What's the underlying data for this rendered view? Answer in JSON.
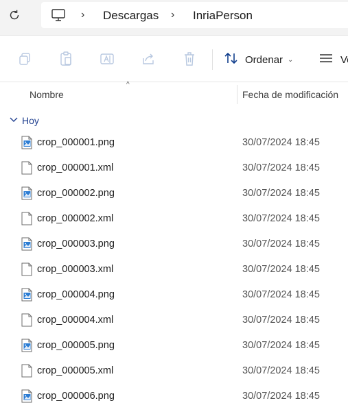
{
  "address": {
    "crumbs": [
      "Descargas",
      "InriaPerson"
    ]
  },
  "toolbar": {
    "sort_label": "Ordenar",
    "view_label": "Ver"
  },
  "columns": {
    "name": "Nombre",
    "date": "Fecha de modificación"
  },
  "group": {
    "label": "Hoy"
  },
  "files": [
    {
      "name": "crop_000001.png",
      "date": "30/07/2024 18:45",
      "type": "png"
    },
    {
      "name": "crop_000001.xml",
      "date": "30/07/2024 18:45",
      "type": "xml"
    },
    {
      "name": "crop_000002.png",
      "date": "30/07/2024 18:45",
      "type": "png"
    },
    {
      "name": "crop_000002.xml",
      "date": "30/07/2024 18:45",
      "type": "xml"
    },
    {
      "name": "crop_000003.png",
      "date": "30/07/2024 18:45",
      "type": "png"
    },
    {
      "name": "crop_000003.xml",
      "date": "30/07/2024 18:45",
      "type": "xml"
    },
    {
      "name": "crop_000004.png",
      "date": "30/07/2024 18:45",
      "type": "png"
    },
    {
      "name": "crop_000004.xml",
      "date": "30/07/2024 18:45",
      "type": "xml"
    },
    {
      "name": "crop_000005.png",
      "date": "30/07/2024 18:45",
      "type": "png"
    },
    {
      "name": "crop_000005.xml",
      "date": "30/07/2024 18:45",
      "type": "xml"
    },
    {
      "name": "crop_000006.png",
      "date": "30/07/2024 18:45",
      "type": "png"
    }
  ],
  "colors": {
    "accent": "#1f3f8f",
    "icon_blue": "#0f6cbd"
  },
  "icons": {
    "refresh": "refresh-icon",
    "computer": "computer-icon",
    "copy": "copy-icon",
    "paste": "paste-icon",
    "rename": "rename-icon",
    "share": "share-icon",
    "delete": "delete-icon",
    "sort": "sort-icon",
    "view": "view-icon",
    "image_file": "image-file-icon",
    "document_file": "document-file-icon"
  }
}
